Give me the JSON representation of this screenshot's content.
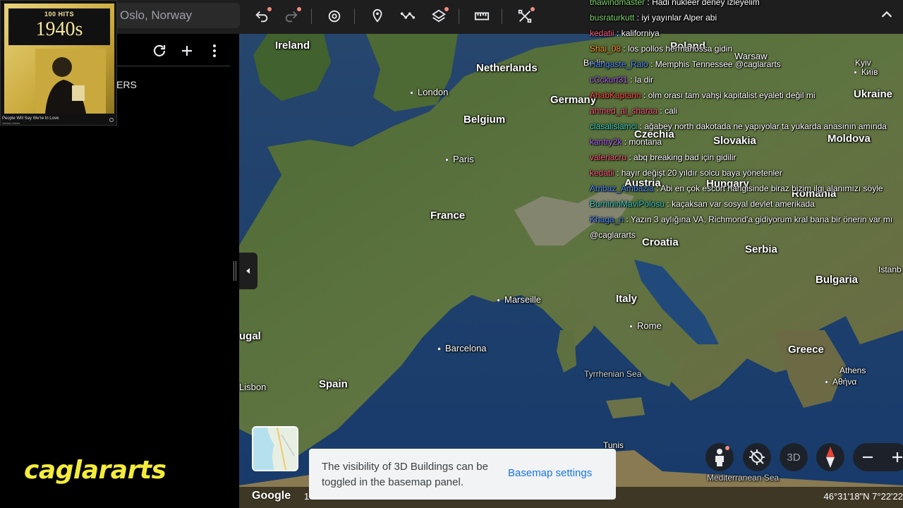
{
  "toolbar": {
    "search_value": "Oslo, Norway",
    "buttons": [
      "undo-icon",
      "redo-icon",
      "history-icon",
      "add-placemark-icon",
      "add-path-icon",
      "layers-icon",
      "measure-icon",
      "projects-icon"
    ]
  },
  "left_panel": {
    "fragment_text": "ERS"
  },
  "album": {
    "hits": "100 HITS",
    "decade": "1940s",
    "track": "People Will Say We're In Love",
    "artist": "Various Artists"
  },
  "map": {
    "countries": [
      {
        "name": "Ireland"
      },
      {
        "name": "Netherlands"
      },
      {
        "name": "Belgium"
      },
      {
        "name": "Germany"
      },
      {
        "name": "France"
      },
      {
        "name": "Czechia"
      },
      {
        "name": "Slovakia"
      },
      {
        "name": "Ukraine"
      },
      {
        "name": "Moldova"
      },
      {
        "name": "Austria"
      },
      {
        "name": "Hungary"
      },
      {
        "name": "Romania"
      },
      {
        "name": "Croatia"
      },
      {
        "name": "Serbia"
      },
      {
        "name": "Bulgaria"
      },
      {
        "name": "Italy"
      },
      {
        "name": "Greece"
      },
      {
        "name": "Spain"
      },
      {
        "name": "ugal"
      },
      {
        "name": "Poland"
      }
    ],
    "cities": [
      {
        "name": "London"
      },
      {
        "name": "Paris"
      },
      {
        "name": "Marseille"
      },
      {
        "name": "Barcelona"
      },
      {
        "name": "Rome"
      },
      {
        "name": "Lisbon"
      },
      {
        "name": "Warsaw"
      },
      {
        "name": "Kyiv"
      },
      {
        "name": "Київ"
      },
      {
        "name": "Istanb"
      },
      {
        "name": "Athens"
      },
      {
        "name": "Αθήνα"
      },
      {
        "name": "Tunis"
      },
      {
        "name": "Berlin"
      }
    ],
    "seas": [
      {
        "name": "Tyrrhenian Sea"
      },
      {
        "name": "Mediterranean Sea"
      }
    ]
  },
  "chat": {
    "messages": [
      {
        "user": "thawindmaster",
        "color": "#7bd46a",
        "text": "Hadi nukleer deney izleyelim"
      },
      {
        "user": "busraturkutt",
        "color": "#7bd46a",
        "text": "iyi yayınlar Alper abi"
      },
      {
        "user": "kedatii",
        "color": "#ff5c7a",
        "text": "kaliforniya"
      },
      {
        "user": "Shai_08",
        "color": "#ff9d2e",
        "text": "los pollos hermanossa gidin"
      },
      {
        "user": "Hangaste_Ralo",
        "color": "#4f8cff",
        "text": "Memphis Tennessee @caglararts"
      },
      {
        "user": "cCckurt31",
        "color": "#b05cff",
        "text": "la dir"
      },
      {
        "user": "AhabKaptann",
        "color": "#ff4d4d",
        "text": "olm orası tam vahşi kapitalist eyaleti değil mi"
      },
      {
        "user": "ahmed_al_sharaa",
        "color": "#ff5c7a",
        "text": "cali"
      },
      {
        "user": "clasalislamci",
        "color": "#3fd0c0",
        "text": "ağabey north dakotada ne yapıyolar ta yukarda anasının amında"
      },
      {
        "user": "kantry2k",
        "color": "#b05cff",
        "text": "montana"
      },
      {
        "user": "valeriacru",
        "color": "#ff5c7a",
        "text": "abq breaking bad için gidilir"
      },
      {
        "user": "kedatii",
        "color": "#ff5c7a",
        "text": "hayır değişt 20 yıldır solcu baya yönetenler"
      },
      {
        "user": "Ambaz_Ambazia",
        "color": "#4f8cff",
        "text": "Abi en çok escort hangisinde biraz bizim ilgi alanımızı söyle"
      },
      {
        "user": "BurhininMaviPolosu",
        "color": "#3fd0c0",
        "text": "kaçaksan var sosyal devlet amerikada"
      },
      {
        "user": "Khaga_n",
        "color": "#4f8cff",
        "text": "Yazın 3 aylığına VA, Richmond'a gidiyorum kral bana bir önerin var mı"
      },
      {
        "user": "",
        "color": "#ffffff",
        "text": "@caglararts"
      }
    ]
  },
  "toast": {
    "text": "The visibility of 3D Buildings can be toggled in the basemap panel.",
    "action": "Basemap settings"
  },
  "bottom": {
    "google": "Google",
    "scale_fragment": "1",
    "coords": "46°31'18\"N 7°22'22",
    "btn_3d": "3D"
  },
  "watermark": "caglararts",
  "colors": {
    "toolbar_bg": "#1e1e1e",
    "accent_blue": "#1a73e8",
    "notification_pink": "#f28b82",
    "watermark_yellow": "#f4ec3c"
  }
}
